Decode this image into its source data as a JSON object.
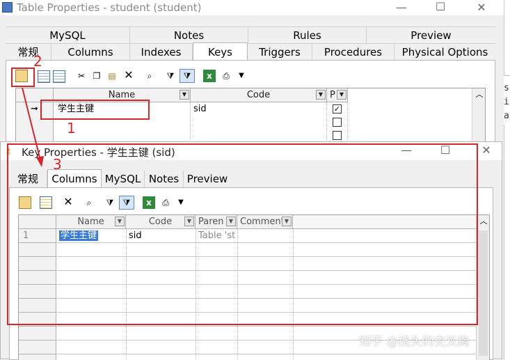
{
  "back_window": {
    "title": "Table Properties - student (student)",
    "controls": {
      "minimize": "—",
      "maximize": "☐",
      "close": "✕"
    },
    "tabs_row1": [
      "MySQL",
      "Notes",
      "Rules",
      "Preview"
    ],
    "tabs_row2": [
      "常规",
      "Columns",
      "Indexes",
      "Keys",
      "Triggers",
      "Procedures",
      "Physical Options"
    ],
    "active_tab": "Keys",
    "grid": {
      "headers": [
        "Name",
        "Code",
        "P"
      ],
      "rows": [
        {
          "name": "学生主键",
          "code": "sid",
          "primary": true
        }
      ]
    },
    "right_clip": [
      "ss",
      "i",
      "a"
    ]
  },
  "front_window": {
    "title": "Key Properties - 学生主键 (sid)",
    "controls": {
      "minimize": "—",
      "maximize": "☐",
      "close": "✕"
    },
    "tabs": [
      "常规",
      "Columns",
      "MySQL",
      "Notes",
      "Preview"
    ],
    "active_tab": "Columns",
    "grid": {
      "headers": [
        "Name",
        "Code",
        "Paren",
        "Comment"
      ],
      "rows": [
        {
          "num": "1",
          "name": "学生主键",
          "code": "sid",
          "parent": "Table 'st",
          "comment": ""
        }
      ]
    }
  },
  "annotations": {
    "n1": "1",
    "n2": "2",
    "n3": "3",
    "color": "#d9252a"
  },
  "watermark": "知乎 @挠头的交叉熵",
  "icons": [
    "properties-icon",
    "insert-row-icon",
    "add-row-icon",
    "cut-icon",
    "copy-icon",
    "paste-icon",
    "delete-icon",
    "find-icon",
    "filter-icon",
    "column-filter-icon",
    "excel-export-icon",
    "print-icon",
    "dropdown-arrow-icon"
  ]
}
